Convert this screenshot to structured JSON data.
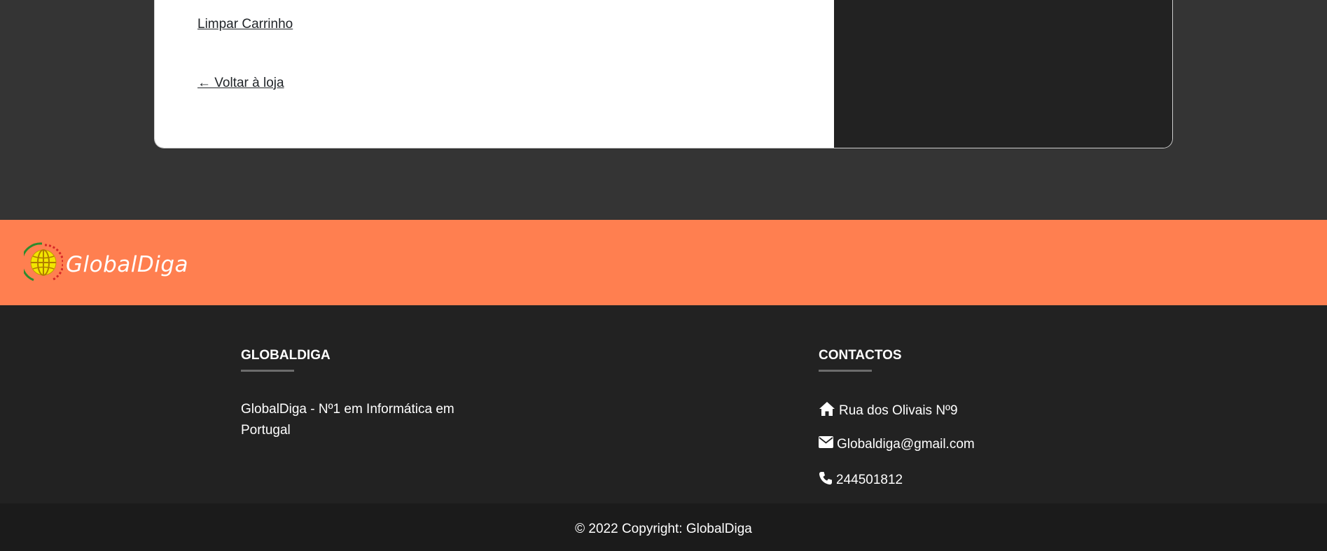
{
  "cart": {
    "clear_label": "Limpar Carrinho",
    "back_label": "← Voltar à loja"
  },
  "brand": {
    "name": "GlobalDiga",
    "bar_color": "#ff7f50"
  },
  "footer": {
    "about": {
      "title": "GLOBALDIGA",
      "text": "GlobalDiga - Nº1 em Informática em Portugal"
    },
    "contacts": {
      "title": "CONTACTOS",
      "address": "Rua dos Olivais Nº9",
      "email": "Globaldiga@gmail.com",
      "phone": "244501812"
    },
    "copyright": "© 2022 Copyright: GlobalDiga"
  },
  "icons": [
    "globe-logo-icon",
    "home-icon",
    "envelope-icon",
    "phone-icon"
  ]
}
